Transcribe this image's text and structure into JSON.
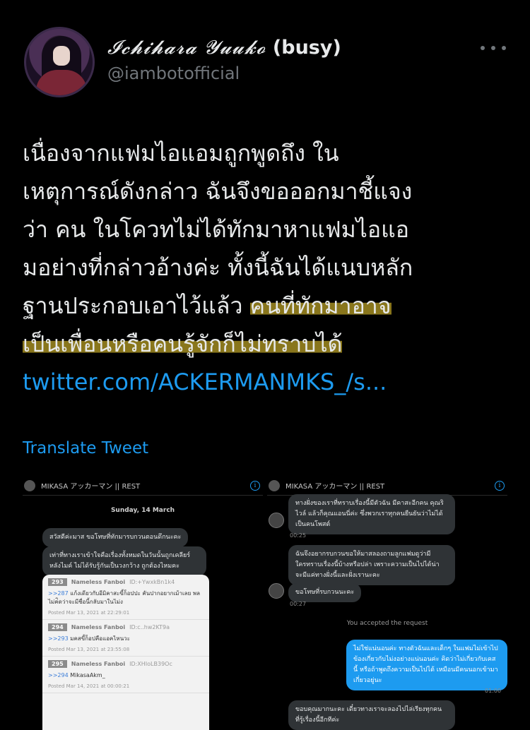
{
  "author": {
    "display_name_fancy": "𝓘𝓬𝓱𝓲𝓱𝓪𝓻𝓪 𝓨𝓾𝓾𝓴𝓸",
    "display_name_suffix": "(busy)",
    "handle": "@iambotofficial"
  },
  "tweet": {
    "lines": [
      "เนื่องจากแฟมไอแอมถูกพูดถึง ใน",
      "เหตุการณ์ดังกล่าว ฉันจึงขอออกมาชี้แจง",
      "ว่า คน ในโควทไม่ได้ทักมาหาแฟมไอแอ",
      "มอย่างที่กล่าวอ้างค่ะ ทั้งนี้ฉันได้แนบหลัก"
    ],
    "line5_plain": "ฐานประกอบเอาไว้แล้ว ",
    "line5_highlight": "คนที่ทักมาอาจ",
    "line6_highlight": "เป็นเพื่อนหรือคนรู้จักก็ไม่ทราบได้",
    "link": "twitter.com/ACKERMANMKS_/s..."
  },
  "translate_label": "Translate Tweet",
  "colors": {
    "accent": "#1d9bf0",
    "highlight": "#b79e26",
    "background": "#000000"
  },
  "left_chat": {
    "header": "MIKASA アッカーマン || REST",
    "date": "Sunday, 14 March",
    "bubble1": "สวัสดีค่ะมาส ขอโทษที่ทักมารบกวนตอนดึกนะคะ",
    "bubble2_l1": "เท่าที่ทางเราเข้าใจคือเรื่องทั้งหมดในวันนั้นถูกเคลียร์",
    "bubble2_l2": "หลังไมค์ ไม่ได้รับรู้กันเป็นวงกว้าง ถูกต้องไหมคะ",
    "posts": [
      {
        "num": "293",
        "author": "Nameless Fanboi",
        "id": "ID:+YwxkBn1k4",
        "ref": ">>287",
        "body": "แก้งเดียวกับอีมิคาสะขี้ก็อปปะ คันปากอยากเม้าเลย พลไม่ค่ิดว่าจะมีชื่อนี้กลับมาในไม่ง",
        "stamp": "Posted Mar 13, 2021 at 22:29:01"
      },
      {
        "num": "294",
        "author": "Nameless Fanboi",
        "id": "ID:c..hw2KT9a",
        "ref": ">>293",
        "body": "มคสขี้ก็อปคือแอคไหนวะ",
        "stamp": "Posted Mar 13, 2021 at 23:55:08"
      },
      {
        "num": "295",
        "author": "Nameless Fanboi",
        "id": "ID:XHIoLB39Oc",
        "ref": ">>294",
        "body": "MikasaAkm_",
        "stamp": "Posted Mar 14, 2021 at 00:00:21"
      }
    ]
  },
  "right_chat": {
    "header": "MIKASA アッカーマン || REST",
    "msg1_l1": "ทางฝั่งของเราที่ทราบเรื่องนี้มีตัวฉัน มีคาสะอีกคน คุณริ",
    "msg1_l2": "ไวล์ แล้วก็คุณแอนนี่ค่ะ ซึ่งพวกเราทุกคนยืนยันว่าไม่ได้",
    "msg1_l3": "เป็นคนโพสต์",
    "time1": "00:25",
    "msg2_l1": "ฉันจึงอยากรบกวนขอให้มาสลองถามลูกแฟมดูว่ามี",
    "msg2_l2": "ใครทราบเรื่องนี้บ้างหรือปล่า เพราะความเป็นไปได้น่า",
    "msg2_l3": "จะมีแค่ทางฝั่งนี้และฝั่งเรานะคะ",
    "msg3": "ขอโทษที่รบกวนนะคะ",
    "time2": "00:27",
    "accepted": "You accepted the request",
    "out_l1": "ไม่ใช่แน่นอนค่ะ ทางตัวฉันและเด็กๆ ในแฟมไม่เข้าไป",
    "out_l2": "ข้องเกี่ยวกับไม่งอย่างแน่นอนค่ะ คิดว่าไม่เกี่ยวกับเคส",
    "out_l3": "นี้ หรือถ้าพูดถึงความเป็นไปได้ เหมือนมีคนนอกเข้ามา",
    "out_l4": "เกี่ยวอยู่นะ",
    "time3": "01:00",
    "msg4_l1": "ขอบคุณมากนะคะ เดี๋ยวทางเราจะลองไปไล่เรียงทุกคน",
    "msg4_l2": "ที่รู้เรื่องนี้อีกทีค่ะ"
  }
}
